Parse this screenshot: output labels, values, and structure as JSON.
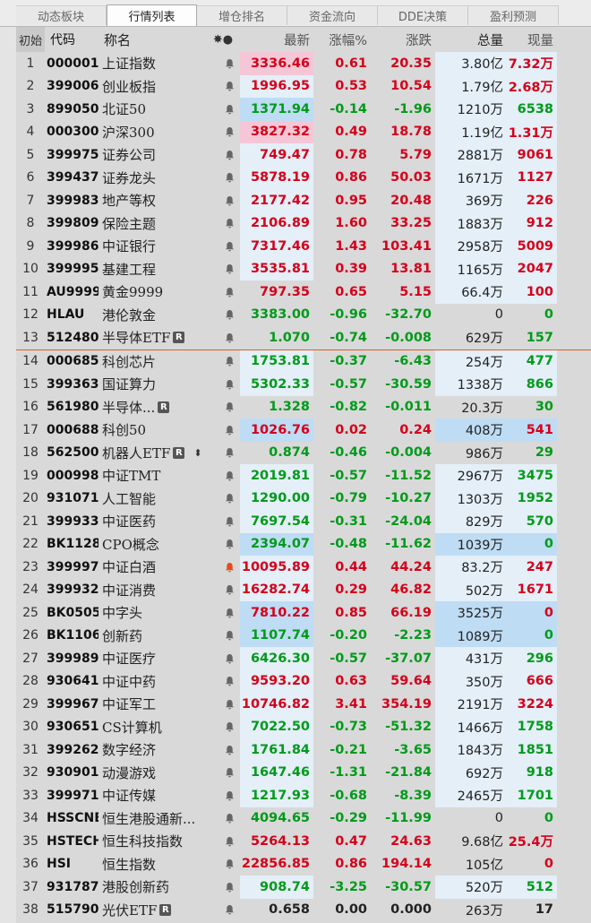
{
  "tabs": [
    "动态板块",
    "行情列表",
    "增仓排名",
    "资金流向",
    "DDE决策",
    "盈利预测"
  ],
  "active_tab": 1,
  "headers": {
    "idx": "初始",
    "code": "代码",
    "name": "称名",
    "icons": "✸●",
    "price": "最新",
    "pct": "涨幅%",
    "chg": "涨跌",
    "vol": "总量",
    "cur": "现量"
  },
  "rows": [
    {
      "idx": "1",
      "code": "000001",
      "name": "上证指数",
      "price": "3336.46",
      "pct": "0.61",
      "chg": "20.35",
      "vol": "3.80亿",
      "cur": "7.32万",
      "dir": "up",
      "price_hl": "pink",
      "vol_hl": "lblue",
      "cur_hl": "lblue"
    },
    {
      "idx": "2",
      "code": "399006",
      "name": "创业板指",
      "price": "1996.95",
      "pct": "0.53",
      "chg": "10.54",
      "vol": "1.79亿",
      "cur": "2.68万",
      "dir": "up",
      "price_hl": "lblue",
      "vol_hl": "lblue",
      "cur_hl": "lblue"
    },
    {
      "idx": "3",
      "code": "899050",
      "name": "北证50",
      "price": "1371.94",
      "pct": "-0.14",
      "chg": "-1.96",
      "vol": "1210万",
      "cur": "6538",
      "dir": "down",
      "price_hl": "blue",
      "vol_hl": "lblue",
      "cur_hl": "lblue"
    },
    {
      "idx": "4",
      "code": "000300",
      "name": "沪深300",
      "price": "3827.32",
      "pct": "0.49",
      "chg": "18.78",
      "vol": "1.19亿",
      "cur": "1.31万",
      "dir": "up",
      "price_hl": "pink",
      "vol_hl": "lblue",
      "cur_hl": "lblue"
    },
    {
      "idx": "5",
      "code": "399975",
      "name": "证券公司",
      "price": "749.47",
      "pct": "0.78",
      "chg": "5.79",
      "vol": "2881万",
      "cur": "9061",
      "dir": "up",
      "price_hl": "lblue",
      "vol_hl": "lblue",
      "cur_hl": "lblue"
    },
    {
      "idx": "6",
      "code": "399437",
      "name": "证券龙头",
      "price": "5878.19",
      "pct": "0.86",
      "chg": "50.03",
      "vol": "1671万",
      "cur": "1127",
      "dir": "up",
      "price_hl": "lblue",
      "vol_hl": "lblue",
      "cur_hl": "lblue"
    },
    {
      "idx": "7",
      "code": "399983",
      "name": "地产等权",
      "price": "2177.42",
      "pct": "0.95",
      "chg": "20.48",
      "vol": "369万",
      "cur": "226",
      "dir": "up",
      "price_hl": "lblue",
      "vol_hl": "lblue",
      "cur_hl": "lblue"
    },
    {
      "idx": "8",
      "code": "399809",
      "name": "保险主题",
      "price": "2106.89",
      "pct": "1.60",
      "chg": "33.25",
      "vol": "1883万",
      "cur": "912",
      "dir": "up",
      "price_hl": "lblue",
      "vol_hl": "lblue",
      "cur_hl": "lblue"
    },
    {
      "idx": "9",
      "code": "399986",
      "name": "中证银行",
      "price": "7317.46",
      "pct": "1.43",
      "chg": "103.41",
      "vol": "2958万",
      "cur": "5009",
      "dir": "up",
      "price_hl": "lblue",
      "vol_hl": "lblue",
      "cur_hl": "lblue"
    },
    {
      "idx": "10",
      "code": "399995",
      "name": "基建工程",
      "price": "3535.81",
      "pct": "0.39",
      "chg": "13.81",
      "vol": "1165万",
      "cur": "2047",
      "dir": "up",
      "price_hl": "lblue",
      "vol_hl": "lblue",
      "cur_hl": "lblue"
    },
    {
      "idx": "11",
      "code": "AU9999",
      "name": "黄金9999",
      "price": "797.35",
      "pct": "0.65",
      "chg": "5.15",
      "vol": "66.4万",
      "cur": "100",
      "dir": "up",
      "price_hl": "",
      "vol_hl": "lblue",
      "cur_hl": "lblue"
    },
    {
      "idx": "12",
      "code": "HLAU",
      "name": "港伦敦金",
      "price": "3383.00",
      "pct": "-0.96",
      "chg": "-32.70",
      "vol": "0",
      "cur": "0",
      "dir": "down",
      "price_hl": "",
      "vol_hl": "",
      "cur_hl": ""
    },
    {
      "idx": "13",
      "code": "512480",
      "name": "半导体ETF",
      "price": "1.070",
      "pct": "-0.74",
      "chg": "-0.008",
      "vol": "629万",
      "cur": "157",
      "dir": "down",
      "price_hl": "",
      "vol_hl": "",
      "cur_hl": "",
      "flag": "R"
    },
    {
      "idx": "14",
      "code": "000685",
      "name": "科创芯片",
      "price": "1753.81",
      "pct": "-0.37",
      "chg": "-6.43",
      "vol": "254万",
      "cur": "477",
      "dir": "down",
      "price_hl": "lblue",
      "vol_hl": "lblue",
      "cur_hl": "lblue"
    },
    {
      "idx": "15",
      "code": "399363",
      "name": "国证算力",
      "price": "5302.33",
      "pct": "-0.57",
      "chg": "-30.59",
      "vol": "1338万",
      "cur": "866",
      "dir": "down",
      "price_hl": "lblue",
      "vol_hl": "lblue",
      "cur_hl": "lblue"
    },
    {
      "idx": "16",
      "code": "561980",
      "name": "半导体...",
      "price": "1.328",
      "pct": "-0.82",
      "chg": "-0.011",
      "vol": "20.3万",
      "cur": "30",
      "dir": "down",
      "price_hl": "",
      "vol_hl": "",
      "cur_hl": "",
      "flag": "R"
    },
    {
      "idx": "17",
      "code": "000688",
      "name": "科创50",
      "price": "1026.76",
      "pct": "0.02",
      "chg": "0.24",
      "vol": "408万",
      "cur": "541",
      "dir": "up",
      "price_hl": "blue",
      "vol_hl": "blue",
      "cur_hl": "blue"
    },
    {
      "idx": "18",
      "code": "562500",
      "name": "机器人ETF",
      "price": "0.874",
      "pct": "-0.46",
      "chg": "-0.004",
      "vol": "986万",
      "cur": "29",
      "dir": "down",
      "price_hl": "",
      "vol_hl": "",
      "cur_hl": "",
      "flag": "R",
      "updown": "⬍"
    },
    {
      "idx": "19",
      "code": "000998",
      "name": "中证TMT",
      "price": "2019.81",
      "pct": "-0.57",
      "chg": "-11.52",
      "vol": "2967万",
      "cur": "3475",
      "dir": "down",
      "price_hl": "lblue",
      "vol_hl": "lblue",
      "cur_hl": "lblue"
    },
    {
      "idx": "20",
      "code": "931071",
      "name": "人工智能",
      "price": "1290.00",
      "pct": "-0.79",
      "chg": "-10.27",
      "vol": "1303万",
      "cur": "1952",
      "dir": "down",
      "price_hl": "lblue",
      "vol_hl": "lblue",
      "cur_hl": "lblue"
    },
    {
      "idx": "21",
      "code": "399933",
      "name": "中证医药",
      "price": "7697.54",
      "pct": "-0.31",
      "chg": "-24.04",
      "vol": "829万",
      "cur": "570",
      "dir": "down",
      "price_hl": "lblue",
      "vol_hl": "lblue",
      "cur_hl": "lblue"
    },
    {
      "idx": "22",
      "code": "BK1128",
      "name": "CPO概念",
      "price": "2394.07",
      "pct": "-0.48",
      "chg": "-11.62",
      "vol": "1039万",
      "cur": "0",
      "dir": "down",
      "price_hl": "blue",
      "vol_hl": "blue",
      "cur_hl": "blue"
    },
    {
      "idx": "23",
      "code": "399997",
      "name": "中证白酒",
      "price": "10095.89",
      "pct": "0.44",
      "chg": "44.24",
      "vol": "83.2万",
      "cur": "247",
      "dir": "up",
      "price_hl": "lblue",
      "vol_hl": "lblue",
      "cur_hl": "lblue",
      "bell_active": true
    },
    {
      "idx": "24",
      "code": "399932",
      "name": "中证消费",
      "price": "16282.74",
      "pct": "0.29",
      "chg": "46.82",
      "vol": "502万",
      "cur": "1671",
      "dir": "up",
      "price_hl": "lblue",
      "vol_hl": "lblue",
      "cur_hl": "lblue"
    },
    {
      "idx": "25",
      "code": "BK0505",
      "name": "中字头",
      "price": "7810.22",
      "pct": "0.85",
      "chg": "66.19",
      "vol": "3525万",
      "cur": "0",
      "dir": "up",
      "price_hl": "blue",
      "vol_hl": "blue",
      "cur_hl": "blue"
    },
    {
      "idx": "26",
      "code": "BK1106",
      "name": "创新药",
      "price": "1107.74",
      "pct": "-0.20",
      "chg": "-2.23",
      "vol": "1089万",
      "cur": "0",
      "dir": "down",
      "price_hl": "blue",
      "vol_hl": "blue",
      "cur_hl": "blue"
    },
    {
      "idx": "27",
      "code": "399989",
      "name": "中证医疗",
      "price": "6426.30",
      "pct": "-0.57",
      "chg": "-37.07",
      "vol": "431万",
      "cur": "296",
      "dir": "down",
      "price_hl": "lblue",
      "vol_hl": "lblue",
      "cur_hl": "lblue"
    },
    {
      "idx": "28",
      "code": "930641",
      "name": "中证中药",
      "price": "9593.20",
      "pct": "0.63",
      "chg": "59.64",
      "vol": "350万",
      "cur": "666",
      "dir": "up",
      "price_hl": "lblue",
      "vol_hl": "lblue",
      "cur_hl": "lblue"
    },
    {
      "idx": "29",
      "code": "399967",
      "name": "中证军工",
      "price": "10746.82",
      "pct": "3.41",
      "chg": "354.19",
      "vol": "2191万",
      "cur": "3224",
      "dir": "up",
      "price_hl": "lblue",
      "vol_hl": "lblue",
      "cur_hl": "lblue"
    },
    {
      "idx": "30",
      "code": "930651",
      "name": "CS计算机",
      "price": "7022.50",
      "pct": "-0.73",
      "chg": "-51.32",
      "vol": "1466万",
      "cur": "1758",
      "dir": "down",
      "price_hl": "lblue",
      "vol_hl": "lblue",
      "cur_hl": "lblue"
    },
    {
      "idx": "31",
      "code": "399262",
      "name": "数字经济",
      "price": "1761.84",
      "pct": "-0.21",
      "chg": "-3.65",
      "vol": "1843万",
      "cur": "1851",
      "dir": "down",
      "price_hl": "lblue",
      "vol_hl": "lblue",
      "cur_hl": "lblue"
    },
    {
      "idx": "32",
      "code": "930901",
      "name": "动漫游戏",
      "price": "1647.46",
      "pct": "-1.31",
      "chg": "-21.84",
      "vol": "692万",
      "cur": "918",
      "dir": "down",
      "price_hl": "lblue",
      "vol_hl": "lblue",
      "cur_hl": "lblue"
    },
    {
      "idx": "33",
      "code": "399971",
      "name": "中证传媒",
      "price": "1217.93",
      "pct": "-0.68",
      "chg": "-8.39",
      "vol": "2465万",
      "cur": "1701",
      "dir": "down",
      "price_hl": "lblue",
      "vol_hl": "lblue",
      "cur_hl": "lblue"
    },
    {
      "idx": "34",
      "code": "HSSCNE",
      "name": "恒生港股通新...",
      "price": "4094.65",
      "pct": "-0.29",
      "chg": "-11.99",
      "vol": "0",
      "cur": "0",
      "dir": "down",
      "price_hl": "",
      "vol_hl": "",
      "cur_hl": ""
    },
    {
      "idx": "35",
      "code": "HSTECH",
      "name": "恒生科技指数",
      "price": "5264.13",
      "pct": "0.47",
      "chg": "24.63",
      "vol": "9.68亿",
      "cur": "25.4万",
      "dir": "up",
      "price_hl": "",
      "vol_hl": "",
      "cur_hl": ""
    },
    {
      "idx": "36",
      "code": "HSI",
      "name": "恒生指数",
      "price": "22856.85",
      "pct": "0.86",
      "chg": "194.14",
      "vol": "105亿",
      "cur": "0",
      "dir": "up",
      "price_hl": "",
      "vol_hl": "",
      "cur_hl": ""
    },
    {
      "idx": "37",
      "code": "931787",
      "name": "港股创新药",
      "price": "908.74",
      "pct": "-3.25",
      "chg": "-30.57",
      "vol": "520万",
      "cur": "512",
      "dir": "down",
      "price_hl": "lblue",
      "vol_hl": "lblue",
      "cur_hl": "lblue"
    },
    {
      "idx": "38",
      "code": "515790",
      "name": "光伏ETF",
      "price": "0.658",
      "pct": "0.00",
      "chg": "0.000",
      "vol": "263万",
      "cur": "17",
      "dir": "flat",
      "price_hl": "",
      "vol_hl": "",
      "cur_hl": "",
      "flag": "R"
    }
  ],
  "divider_after_row": 13,
  "colors": {
    "up": "#d4001a",
    "down": "#009a1a",
    "divider": "#e06020",
    "bell_active": "#e84a1a",
    "bell": "#666666"
  }
}
